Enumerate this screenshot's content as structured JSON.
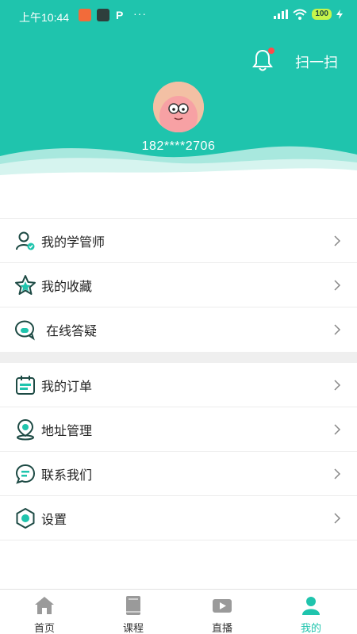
{
  "status_bar": {
    "time": "上午10:44",
    "dots": "···",
    "p_glyph": "P",
    "battery": "100"
  },
  "header": {
    "scan_label": "扫一扫",
    "phone": "182****2706"
  },
  "menu_group_1": [
    {
      "label": "我的学管师",
      "icon": "teacher-icon"
    },
    {
      "label": "我的收藏",
      "icon": "star-icon"
    },
    {
      "label": "在线答疑",
      "icon": "chat-question-icon"
    }
  ],
  "menu_group_2": [
    {
      "label": "我的订单",
      "icon": "calendar-order-icon"
    },
    {
      "label": "地址管理",
      "icon": "location-icon"
    },
    {
      "label": "联系我们",
      "icon": "contact-chat-icon"
    },
    {
      "label": "设置",
      "icon": "settings-icon"
    }
  ],
  "tabs": [
    {
      "label": "首页",
      "icon": "home-icon"
    },
    {
      "label": "课程",
      "icon": "book-icon"
    },
    {
      "label": "直播",
      "icon": "live-icon"
    },
    {
      "label": "我的",
      "icon": "profile-icon"
    }
  ],
  "colors": {
    "accent": "#1fc4ad",
    "icon_dark": "#1d4a44",
    "notification_dot": "#ff4a4a"
  }
}
